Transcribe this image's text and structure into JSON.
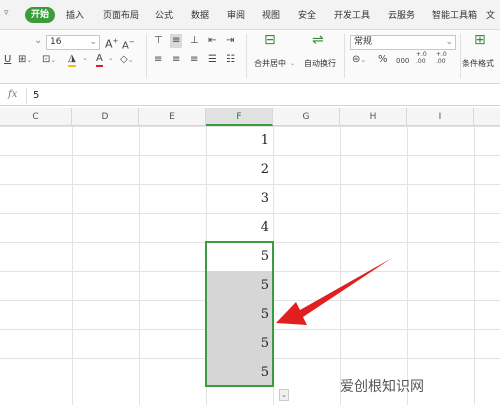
{
  "menu": {
    "start": "开始",
    "items": [
      "插入",
      "页面布局",
      "公式",
      "数据",
      "审阅",
      "视图",
      "安全",
      "开发工具",
      "云服务",
      "智能工具箱",
      "文"
    ]
  },
  "ribbon": {
    "font_size": "16",
    "font_grow": "A",
    "font_shrink": "A",
    "merge_label": "合并居中",
    "wrap_label": "自动换行",
    "number_format": "常规",
    "percent": "%",
    "thousands": "000",
    "dec_inc": "+.0 .00",
    "dec_dec": "+.0 .00",
    "cond_format_label": "条件格式"
  },
  "formula_bar": {
    "fx": "fx",
    "value": "5"
  },
  "columns": [
    "C",
    "D",
    "E",
    "F",
    "G",
    "H",
    "I"
  ],
  "active_column": "F",
  "column_f_values": [
    "1",
    "2",
    "3",
    "4",
    "5",
    "5",
    "5",
    "5",
    "5"
  ],
  "watermark": "爱创根知识网",
  "colors": {
    "accent": "#3a9c3a",
    "arrow": "#e02020"
  }
}
